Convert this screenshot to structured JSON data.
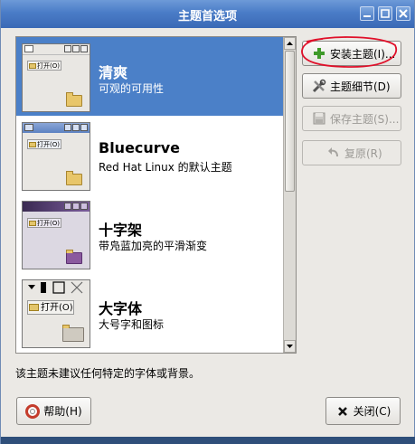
{
  "window": {
    "title": "主题首选项"
  },
  "themes": [
    {
      "name": "清爽",
      "description": "可观的可用性",
      "thumb_label": "打开(O)",
      "selected": true
    },
    {
      "name": "Bluecurve",
      "description": "Red Hat Linux 的默认主题",
      "thumb_label": "打开(O)",
      "selected": false
    },
    {
      "name": "十字架",
      "description": "带凫蓝加亮的平滑渐变",
      "thumb_label": "打开(O)",
      "selected": false
    },
    {
      "name": "大字体",
      "description": "大号字和图标",
      "thumb_label": "打开(O)",
      "selected": false
    }
  ],
  "buttons": {
    "install": "安装主题(I)...",
    "details": "主题细节(D)",
    "save": "保存主题(S)...",
    "revert": "复原(R)",
    "help": "帮助(H)",
    "close": "关闭(C)"
  },
  "status_text": "该主题未建议任何特定的字体或背景。",
  "colors": {
    "selection": "#4b80c8",
    "titlebar": "#4a7cc7",
    "annotation": "#e0102a"
  },
  "icons": {
    "install": "green-plus-icon",
    "details": "tools-icon",
    "save": "floppy-icon",
    "revert": "undo-arrow-icon",
    "help": "lifebuoy-icon",
    "close": "x-icon"
  }
}
